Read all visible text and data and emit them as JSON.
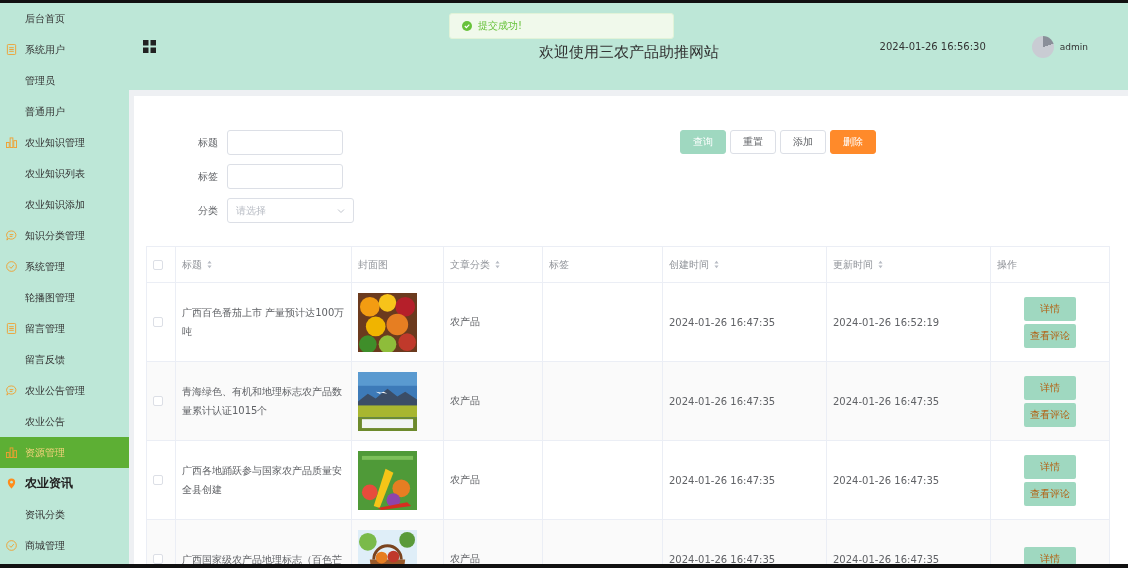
{
  "sidebar": {
    "items": [
      {
        "label": "后台首页",
        "kind": "sub",
        "selected": false
      },
      {
        "label": "系统用户",
        "kind": "group",
        "selected": false
      },
      {
        "label": "管理员",
        "kind": "sub",
        "selected": false
      },
      {
        "label": "普通用户",
        "kind": "sub",
        "selected": false
      },
      {
        "label": "农业知识管理",
        "kind": "group",
        "selected": false
      },
      {
        "label": "农业知识列表",
        "kind": "sub",
        "selected": false
      },
      {
        "label": "农业知识添加",
        "kind": "sub",
        "selected": false
      },
      {
        "label": "知识分类管理",
        "kind": "group",
        "selected": false
      },
      {
        "label": "系统管理",
        "kind": "group",
        "selected": false
      },
      {
        "label": "轮播图管理",
        "kind": "sub",
        "selected": false
      },
      {
        "label": "留言管理",
        "kind": "group",
        "selected": false
      },
      {
        "label": "留言反馈",
        "kind": "sub",
        "selected": false
      },
      {
        "label": "农业公告管理",
        "kind": "group",
        "selected": false
      },
      {
        "label": "农业公告",
        "kind": "sub",
        "selected": false
      },
      {
        "label": "资源管理",
        "kind": "group",
        "selected": true
      },
      {
        "label": "农业资讯",
        "kind": "title",
        "selected": false
      },
      {
        "label": "资讯分类",
        "kind": "sub",
        "selected": false
      },
      {
        "label": "商城管理",
        "kind": "group",
        "selected": false
      }
    ]
  },
  "header": {
    "title": "欢迎使用三农产品助推网站",
    "datetime": "2024-01-26 16:56:30",
    "user": "admin"
  },
  "toast": {
    "message": "提交成功!"
  },
  "filters": [
    {
      "label": "标题",
      "kind": "text"
    },
    {
      "label": "标签",
      "kind": "text"
    },
    {
      "label": "分类",
      "kind": "select",
      "placeholder": "请选择"
    }
  ],
  "actions": [
    {
      "label": "查询",
      "kind": "primary"
    },
    {
      "label": "重置",
      "kind": "plain"
    },
    {
      "label": "添加",
      "kind": "plain"
    },
    {
      "label": "删除",
      "kind": "danger"
    }
  ],
  "table": {
    "all_checked": false,
    "columns": [
      {
        "label": "标题",
        "sortable": true
      },
      {
        "label": "封面图",
        "sortable": false
      },
      {
        "label": "文章分类",
        "sortable": true
      },
      {
        "label": "标签",
        "sortable": false
      },
      {
        "label": "创建时间",
        "sortable": true
      },
      {
        "label": "更新时间",
        "sortable": true
      },
      {
        "label": "操作",
        "sortable": false
      }
    ],
    "rows": [
      {
        "checked": false,
        "title": "广西百色番茄上市 产量预计达100万吨",
        "cover": {
          "kind": "picture"
        },
        "category": "农产品",
        "created": "2024-01-26 16:47:35",
        "updated": "2024-01-26 16:52:19",
        "actions": [
          "详情",
          "查看评论"
        ]
      },
      {
        "checked": false,
        "title": "青海绿色、有机和地理标志农产品数量累计认证1015个",
        "cover": {
          "kind": "picture"
        },
        "category": "农产品",
        "created": "2024-01-26 16:47:35",
        "updated": "2024-01-26 16:47:35",
        "actions": [
          "详情",
          "查看评论"
        ]
      },
      {
        "checked": false,
        "title": "广西各地踊跃参与国家农产品质量安全县创建",
        "cover": {
          "kind": "picture"
        },
        "category": "农产品",
        "created": "2024-01-26 16:47:35",
        "updated": "2024-01-26 16:47:35",
        "actions": [
          "详情",
          "查看评论"
        ]
      },
      {
        "checked": false,
        "title": "广西国家级农产品地理标志（百色芒",
        "cover": {
          "kind": "picture"
        },
        "category": "农产品",
        "created": "2024-01-26 16:47:35",
        "updated": "2024-01-26 16:47:35",
        "actions": [
          "详情"
        ]
      }
    ]
  }
}
